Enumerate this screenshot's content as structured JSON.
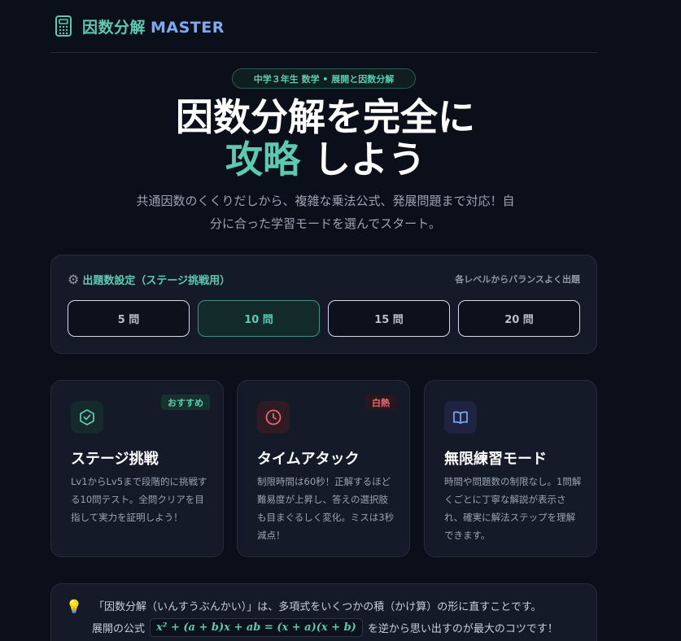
{
  "header": {
    "logo_text_a": "因数分解",
    "logo_text_b": "MASTER",
    "logo_icon": "calculator-icon"
  },
  "hero": {
    "badge": "中学３年生 数学 • 展開と因数分解",
    "title_line1": "因数分解を完全に",
    "title_accent": "攻略",
    "title_rest": " しよう",
    "subtitle": "共通因数のくくりだしから、複雑な乗法公式、発展問題まで対応！自分に合った学習モードを選んでスタート。"
  },
  "settings": {
    "gear_icon": "gear-icon",
    "title": "出題数設定（ステージ挑戦用）",
    "note": "各レベルからバランスよく出題",
    "options": [
      "5 問",
      "10 問",
      "15 問",
      "20 問"
    ],
    "selected": "10 問"
  },
  "modes": [
    {
      "icon": "hexagon-check-icon",
      "tag": "おすすめ",
      "title": "ステージ挑戦",
      "desc": "Lv1からLv5まで段階的に挑戦する10問テスト。全問クリアを目指して実力を証明しよう！"
    },
    {
      "icon": "clock-icon",
      "tag": "白熱",
      "title": "タイムアタック",
      "desc": "制限時間は60秒！正解するほど難易度が上昇し、答えの選択肢も目まぐるしく変化。ミスは3秒減点！"
    },
    {
      "icon": "book-icon",
      "title": "無限練習モード",
      "desc": "時間や問題数の制限なし。1問解くごとに丁寧な解説が表示され、確実に解法ステップを理解できます。"
    }
  ],
  "colors": {
    "accent": "#5ec9b3",
    "secondary": "#7ea9f0",
    "hot": "#e06a72",
    "background": "#0b0f1a",
    "card": "#141a27"
  },
  "tip": {
    "icon": "lightbulb-icon",
    "line1": "「因数分解（いんすうぶんかい）」は、多項式をいくつかの積（かけ算）の形に直すことです。",
    "line2_pre": "展開の公式",
    "formula": "x² + (a + b)x + ab = (x + a)(x + b)",
    "line2_post": "を逆から思い出すのが最大のコツです！"
  }
}
